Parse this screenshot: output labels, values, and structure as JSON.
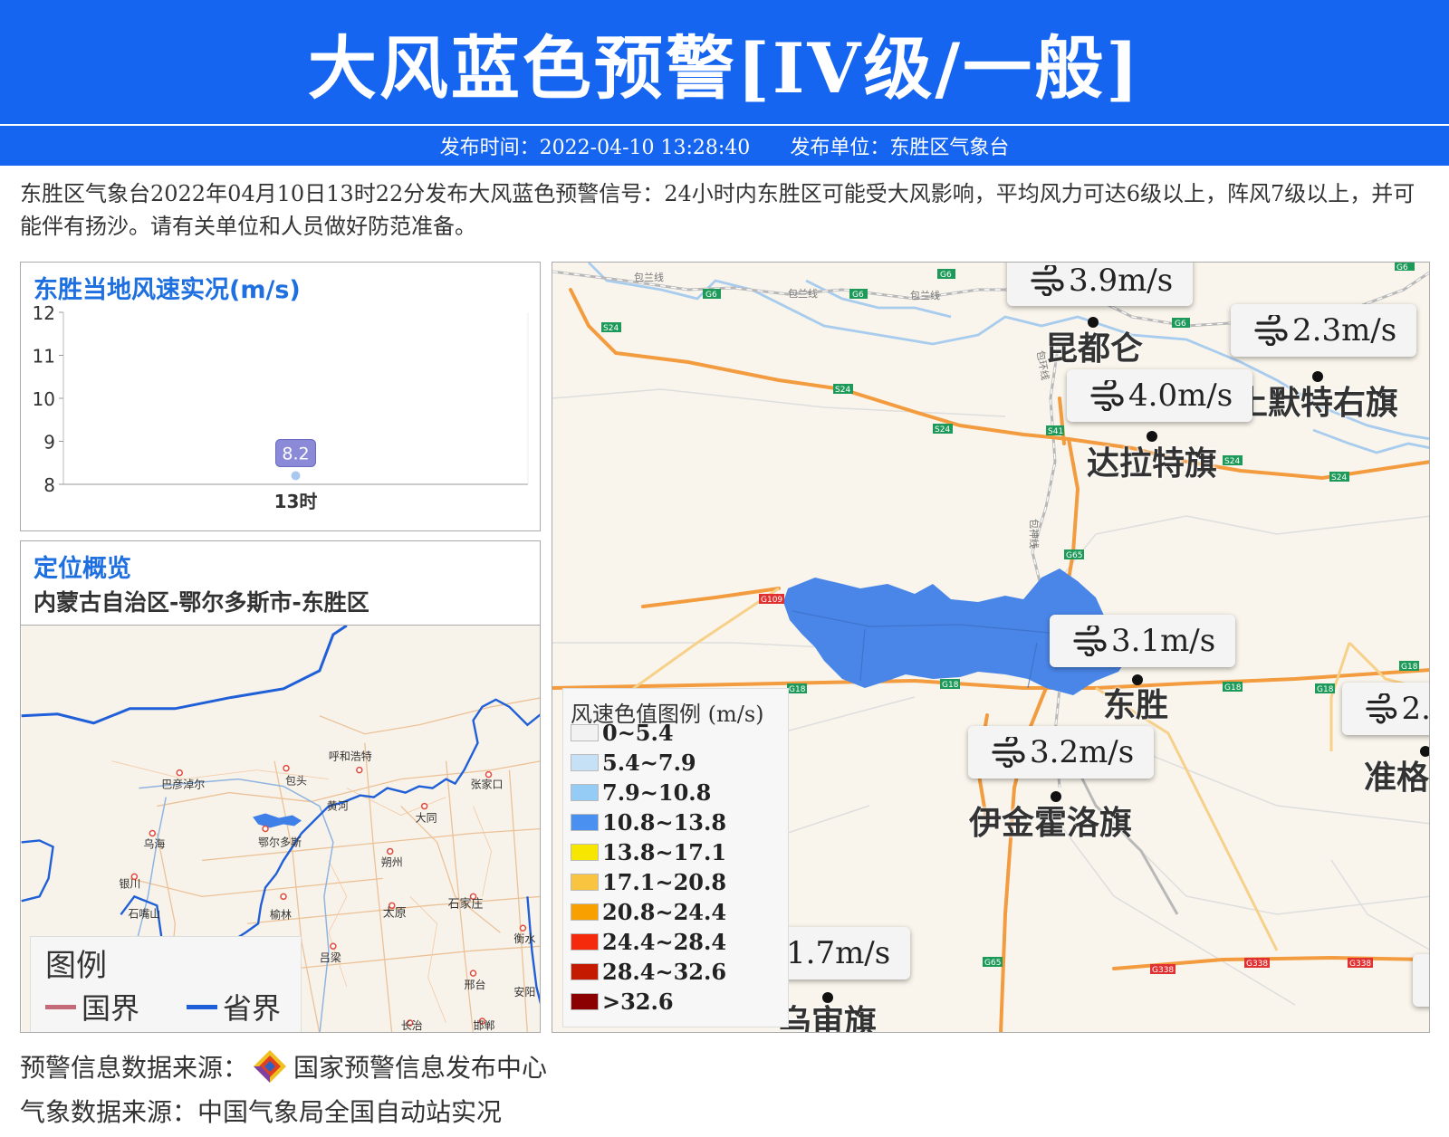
{
  "header": {
    "title": "大风蓝色预警[IV级/一般]",
    "publish_time": "发布时间：2022-04-10 13:28:40",
    "publisher": "发布单位：东胜区气象台"
  },
  "description": "东胜区气象台2022年04月10日13时22分发布大风蓝色预警信号：24小时内东胜区可能受大风影响，平均风力可达6级以上，阵风7级以上，并可能伴有扬沙。请有关单位和人员做好防范准备。",
  "wind_chart": {
    "title": "东胜当地风速实况(m/s)",
    "point_label": "8.2"
  },
  "chart_data": {
    "type": "line",
    "title": "东胜当地风速实况(m/s)",
    "categories": [
      "13时"
    ],
    "series": [
      {
        "values": [
          8.2
        ]
      }
    ],
    "ylim": [
      8,
      12
    ],
    "yticks": [
      "8",
      "9",
      "10",
      "11",
      "12"
    ],
    "grid": false
  },
  "location": {
    "title": "定位概览",
    "path": "内蒙古自治区-鄂尔多斯市-东胜区",
    "legend_title": "图例",
    "legend_items": [
      {
        "label": "国界",
        "color": "#c46b7a"
      },
      {
        "label": "省界",
        "color": "#1f5fd8"
      }
    ],
    "cities": [
      "呼和浩特",
      "包头",
      "巴彦淖尔",
      "乌海",
      "鄂尔多斯",
      "银川",
      "黄河",
      "张家口",
      "大同",
      "朔州",
      "榆林",
      "太原",
      "石家庄",
      "吕梁",
      "衡水",
      "邢台",
      "长治",
      "邯郸",
      "石嘴山",
      "安阳"
    ]
  },
  "main_map": {
    "stations": [
      {
        "speed": "3.9m/s",
        "city": "昆都仑"
      },
      {
        "speed": "2.3m/s",
        "city": "土默特右旗"
      },
      {
        "speed": "4.0m/s",
        "city": "达拉特旗"
      },
      {
        "speed": "3.1m/s",
        "city": "东胜"
      },
      {
        "speed": "3.2m/s",
        "city": "伊金霍洛旗"
      },
      {
        "speed": "2.",
        "city": "准格"
      },
      {
        "speed": "1.7m/s",
        "city": "乌审旗"
      }
    ],
    "road_labels": [
      "G6",
      "S24",
      "S41",
      "G65",
      "G109",
      "G18",
      "G338",
      "包兰线",
      "包神线",
      "包环线"
    ],
    "warning_area_color": "#4a86e8"
  },
  "scale_legend": {
    "title": "风速色值图例 (m/s)",
    "items": [
      {
        "label": "0~5.4",
        "color": "#f2f2f2"
      },
      {
        "label": "5.4~7.9",
        "color": "#c6e0f5"
      },
      {
        "label": "7.9~10.8",
        "color": "#95ccf5"
      },
      {
        "label": "10.8~13.8",
        "color": "#4a90f0"
      },
      {
        "label": "13.8~17.1",
        "color": "#f7e600"
      },
      {
        "label": "17.1~20.8",
        "color": "#f9c440"
      },
      {
        "label": "20.8~24.4",
        "color": "#f8a000"
      },
      {
        "label": "24.4~28.4",
        "color": "#f52a0c"
      },
      {
        "label": "28.4~32.6",
        "color": "#c41a00"
      },
      {
        "label": ">32.6",
        "color": "#8b0000"
      }
    ]
  },
  "sources": {
    "warning_source_label": "预警信息数据来源：",
    "warning_source": "国家预警信息发布中心",
    "weather_source": "气象数据来源：中国气象局全国自动站实况"
  }
}
